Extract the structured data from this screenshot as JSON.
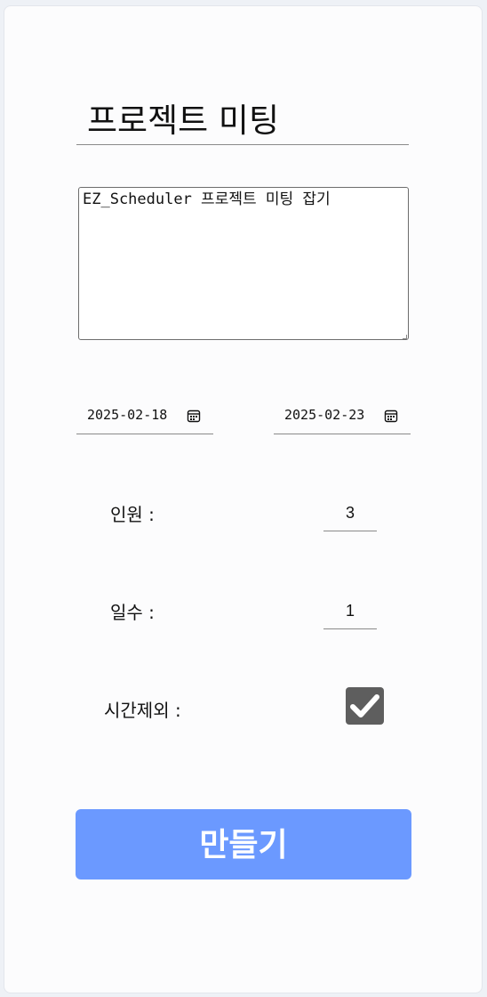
{
  "form": {
    "title_value": "프로젝트 미팅",
    "description_value": "EZ_Scheduler 프로젝트 미팅 잡기",
    "start_date": "2025-02-18",
    "end_date": "2025-02-23",
    "people_label": "인원 :",
    "people_value": "3",
    "days_label": "일수 :",
    "days_value": "1",
    "exclude_time_label": "시간제외 :",
    "exclude_time_checked": true,
    "submit_label": "만들기"
  },
  "colors": {
    "accent": "#6b99ff",
    "checkbox": "#5e5e5e"
  },
  "icons": {
    "date_picker": "calendar-icon",
    "checkbox_mark": "checkmark-icon"
  }
}
